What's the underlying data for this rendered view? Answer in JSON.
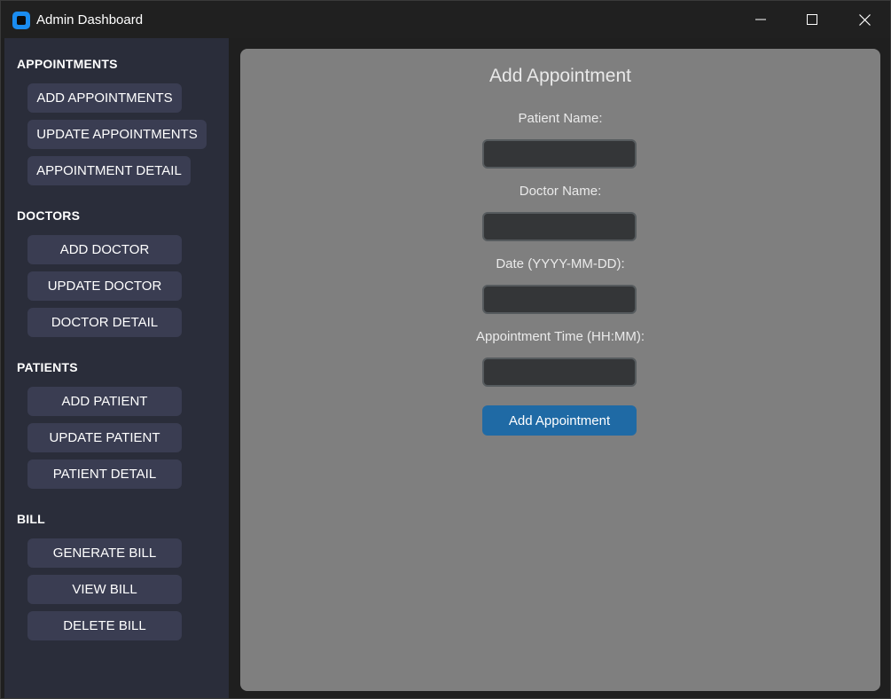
{
  "window": {
    "title": "Admin Dashboard"
  },
  "colors": {
    "sidebar_bg": "#2a2d3a",
    "sidebar_button": "#3a3d52",
    "main_panel": "#7f7f7f",
    "input_bg": "#343638",
    "primary_button": "#1f6aa5",
    "app_icon": "#1a8cf0"
  },
  "icons": {
    "app": "app-icon",
    "minimize": "minimize-icon",
    "maximize": "maximize-icon",
    "close": "close-icon"
  },
  "sidebar": {
    "sections": [
      {
        "title": "APPOINTMENTS",
        "buttons": [
          "ADD APPOINTMENTS",
          "UPDATE APPOINTMENTS",
          "APPOINTMENT DETAIL"
        ]
      },
      {
        "title": "DOCTORS",
        "buttons": [
          "ADD DOCTOR",
          "UPDATE DOCTOR",
          "DOCTOR DETAIL"
        ]
      },
      {
        "title": "PATIENTS",
        "buttons": [
          "ADD PATIENT",
          "UPDATE PATIENT",
          "PATIENT DETAIL"
        ]
      },
      {
        "title": "BILL",
        "buttons": [
          "GENERATE BILL",
          "VIEW BILL",
          "DELETE BILL"
        ]
      }
    ]
  },
  "form": {
    "title": "Add Appointment",
    "fields": [
      {
        "label": "Patient Name:",
        "value": ""
      },
      {
        "label": "Doctor Name:",
        "value": ""
      },
      {
        "label": "Date (YYYY-MM-DD):",
        "value": ""
      },
      {
        "label": "Appointment Time (HH:MM):",
        "value": ""
      }
    ],
    "submit_label": "Add Appointment"
  }
}
